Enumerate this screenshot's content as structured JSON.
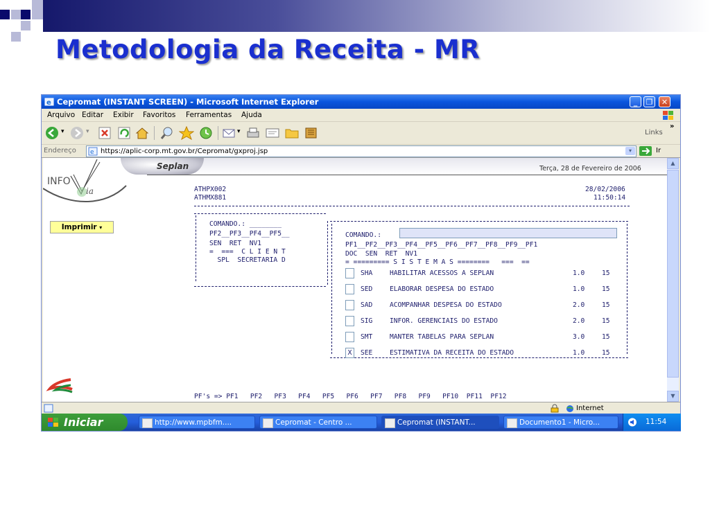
{
  "slide": {
    "title": "Metodologia da Receita - MR"
  },
  "window": {
    "title": "Cepromat (INSTANT SCREEN) - Microsoft Internet Explorer",
    "menu": [
      "Arquivo",
      "Editar",
      "Exibir",
      "Favoritos",
      "Ferramentas",
      "Ajuda"
    ],
    "links_label": "Links",
    "address_label": "Endereço",
    "url": "https://aplic-corp.mt.gov.br/Cepromat/gxproj.jsp",
    "go_label": "Ir"
  },
  "page": {
    "org": "Seplan",
    "date_long": "Terça, 28 de Fevereiro de 2006",
    "print_label": "Imprimir",
    "screen_ids": [
      "ATHPX002",
      "ATHMX881"
    ],
    "date": "28/02/2006",
    "time": "11:50:14",
    "left_panel": {
      "command_label": "COMANDO.: ________",
      "pf_line": "PF2__PF3__PF4__PF5__",
      "cols": "SEN  RET  NV1",
      "client_line": "=  ===  C L I E N T",
      "spl_line": "  SPL  SECRETARIA D"
    },
    "right_panel": {
      "command_label": "COMANDO.:",
      "pf_line": "PF1__PF2__PF3__PF4__PF5__PF6__PF7__PF8__PF9__PF1",
      "cols": "DOC  SEN  RET  NV1",
      "sys_header": "= ========= S I S T E M A S ========   ===  ==",
      "systems": [
        {
          "check": "",
          "code": "SHA",
          "desc": "HABILITAR ACESSOS A SEPLAN",
          "ver": "1.0",
          "num": "15"
        },
        {
          "check": "",
          "code": "SED",
          "desc": "ELABORAR DESPESA DO ESTADO",
          "ver": "1.0",
          "num": "15"
        },
        {
          "check": "",
          "code": "SAD",
          "desc": "ACOMPANHAR DESPESA DO ESTADO",
          "ver": "2.0",
          "num": "15"
        },
        {
          "check": "",
          "code": "SIG",
          "desc": "INFOR. GERENCIAIS DO ESTADO",
          "ver": "2.0",
          "num": "15"
        },
        {
          "check": "",
          "code": "SMT",
          "desc": "MANTER TABELAS PARA SEPLAN",
          "ver": "3.0",
          "num": "15"
        },
        {
          "check": "X",
          "code": "SEE",
          "desc": "ESTIMATIVA DA RECEITA DO ESTADO",
          "ver": "1.0",
          "num": "15"
        }
      ]
    },
    "footer_keys": "PF's => PF1   PF2   PF3   PF4   PF5   PF6   PF7   PF8   PF9   PF10  PF11  PF12"
  },
  "status": {
    "zone": "Internet"
  },
  "taskbar": {
    "start_label": "Iniciar",
    "items": [
      {
        "label": "http://www.mpbfm...."
      },
      {
        "label": "Cepromat - Centro ..."
      },
      {
        "label": "Cepromat (INSTANT..."
      },
      {
        "label": "Documento1 - Micro..."
      }
    ],
    "clock": "11:54"
  },
  "colors": {
    "title": "#1a2fcf",
    "xp_blue": "#0a55dd",
    "start_green": "#3d9e3b",
    "terminal_text": "#1c1c6b"
  }
}
